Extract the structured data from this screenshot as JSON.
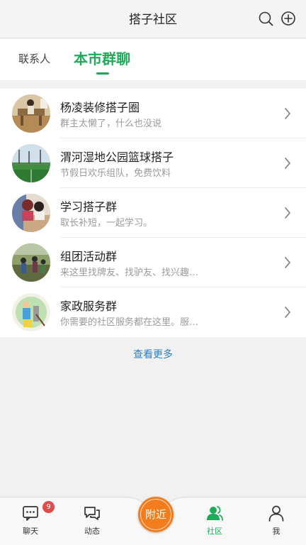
{
  "header": {
    "title": "搭子社区",
    "search_icon": "search-icon",
    "add_icon": "plus-circle-icon"
  },
  "tabs": [
    {
      "label": "联系人",
      "active": false
    },
    {
      "label": "本市群聊",
      "active": true
    }
  ],
  "groups": [
    {
      "name": "杨凌装修搭子圈",
      "desc": "群主太懒了，什么也没说",
      "avatar": "renovation-photo"
    },
    {
      "name": "渭河湿地公园篮球搭子",
      "desc": "节假日欢乐组队，免费饮料",
      "avatar": "basketball-court-photo"
    },
    {
      "name": "学习搭子群",
      "desc": "取长补短，一起学习。",
      "avatar": "study-photo"
    },
    {
      "name": "组团活动群",
      "desc": "来这里找牌友、找驴友、找兴趣…",
      "avatar": "hiking-photo"
    },
    {
      "name": "家政服务群",
      "desc": "你需要的社区服务都在这里。服…",
      "avatar": "housekeeping-illustration"
    }
  ],
  "more_label": "查看更多",
  "bottom_nav": {
    "items": [
      {
        "label": "聊天",
        "icon": "chat-bubble-icon",
        "badge": "9",
        "active": false
      },
      {
        "label": "动态",
        "icon": "messages-icon",
        "active": false
      },
      {
        "label": "社区",
        "icon": "community-icon",
        "active": true
      },
      {
        "label": "我",
        "icon": "person-icon",
        "active": false
      }
    ],
    "center_label": "附近"
  },
  "colors": {
    "accent": "#1dab5a",
    "link": "#2b7fc6",
    "badge": "#e04b4b",
    "center_button": "#f37c1d"
  }
}
